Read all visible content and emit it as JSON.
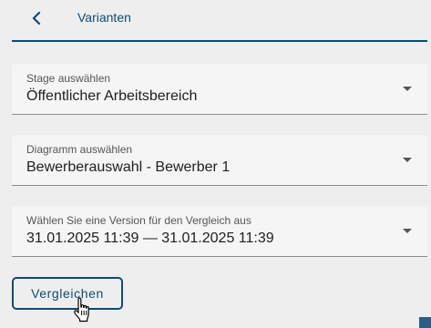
{
  "header": {
    "title": "Varianten",
    "back_icon": "chevron-left-icon"
  },
  "selects": [
    {
      "label": "Stage auswählen",
      "value": "Öffentlicher Arbeitsbereich"
    },
    {
      "label": "Diagramm auswählen",
      "value": "Bewerberauswahl - Bewerber 1"
    },
    {
      "label": "Wählen Sie eine Version für den Vergleich aus",
      "value": "31.01.2025 11:39 — 31.01.2025 11:39"
    }
  ],
  "actions": {
    "compare_label": "Vergleichen"
  },
  "colors": {
    "accent": "#0f4a73",
    "background": "#eeeeee",
    "field_background": "#f5f5f5"
  }
}
